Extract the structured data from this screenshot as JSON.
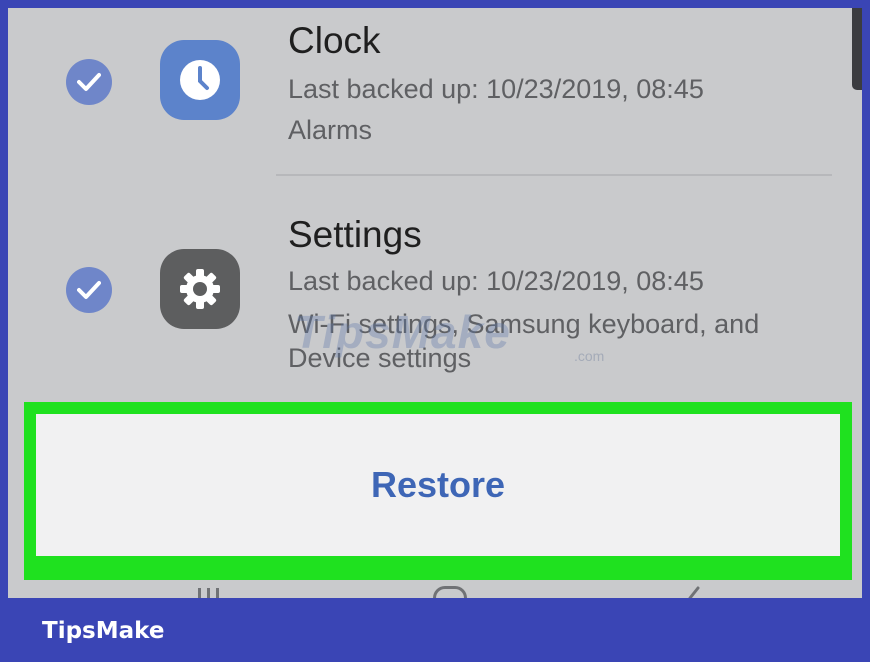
{
  "items": [
    {
      "title": "Clock",
      "last_backup": "Last backed up: 10/23/2019, 08:45",
      "details_line1": "Alarms",
      "icon": "clock-icon",
      "checked": true
    },
    {
      "title": "Settings",
      "last_backup": "Last backed up: 10/23/2019, 08:45",
      "details_line1": "Wi-Fi settings, Samsung keyboard, and",
      "details_line2": "Device settings",
      "icon": "gear-icon",
      "checked": true
    }
  ],
  "action": {
    "restore_label": "Restore"
  },
  "watermark": {
    "text": "TipsMake",
    "suffix": ".com"
  },
  "footer": {
    "brand": "TipsMake"
  },
  "colors": {
    "frame": "#3a45b5",
    "highlight": "#1fe11f",
    "accent": "#3e66b6",
    "check": "#6f86c9",
    "clock_icon_bg": "#5c83cb",
    "settings_icon_bg": "#5d5e5f"
  }
}
